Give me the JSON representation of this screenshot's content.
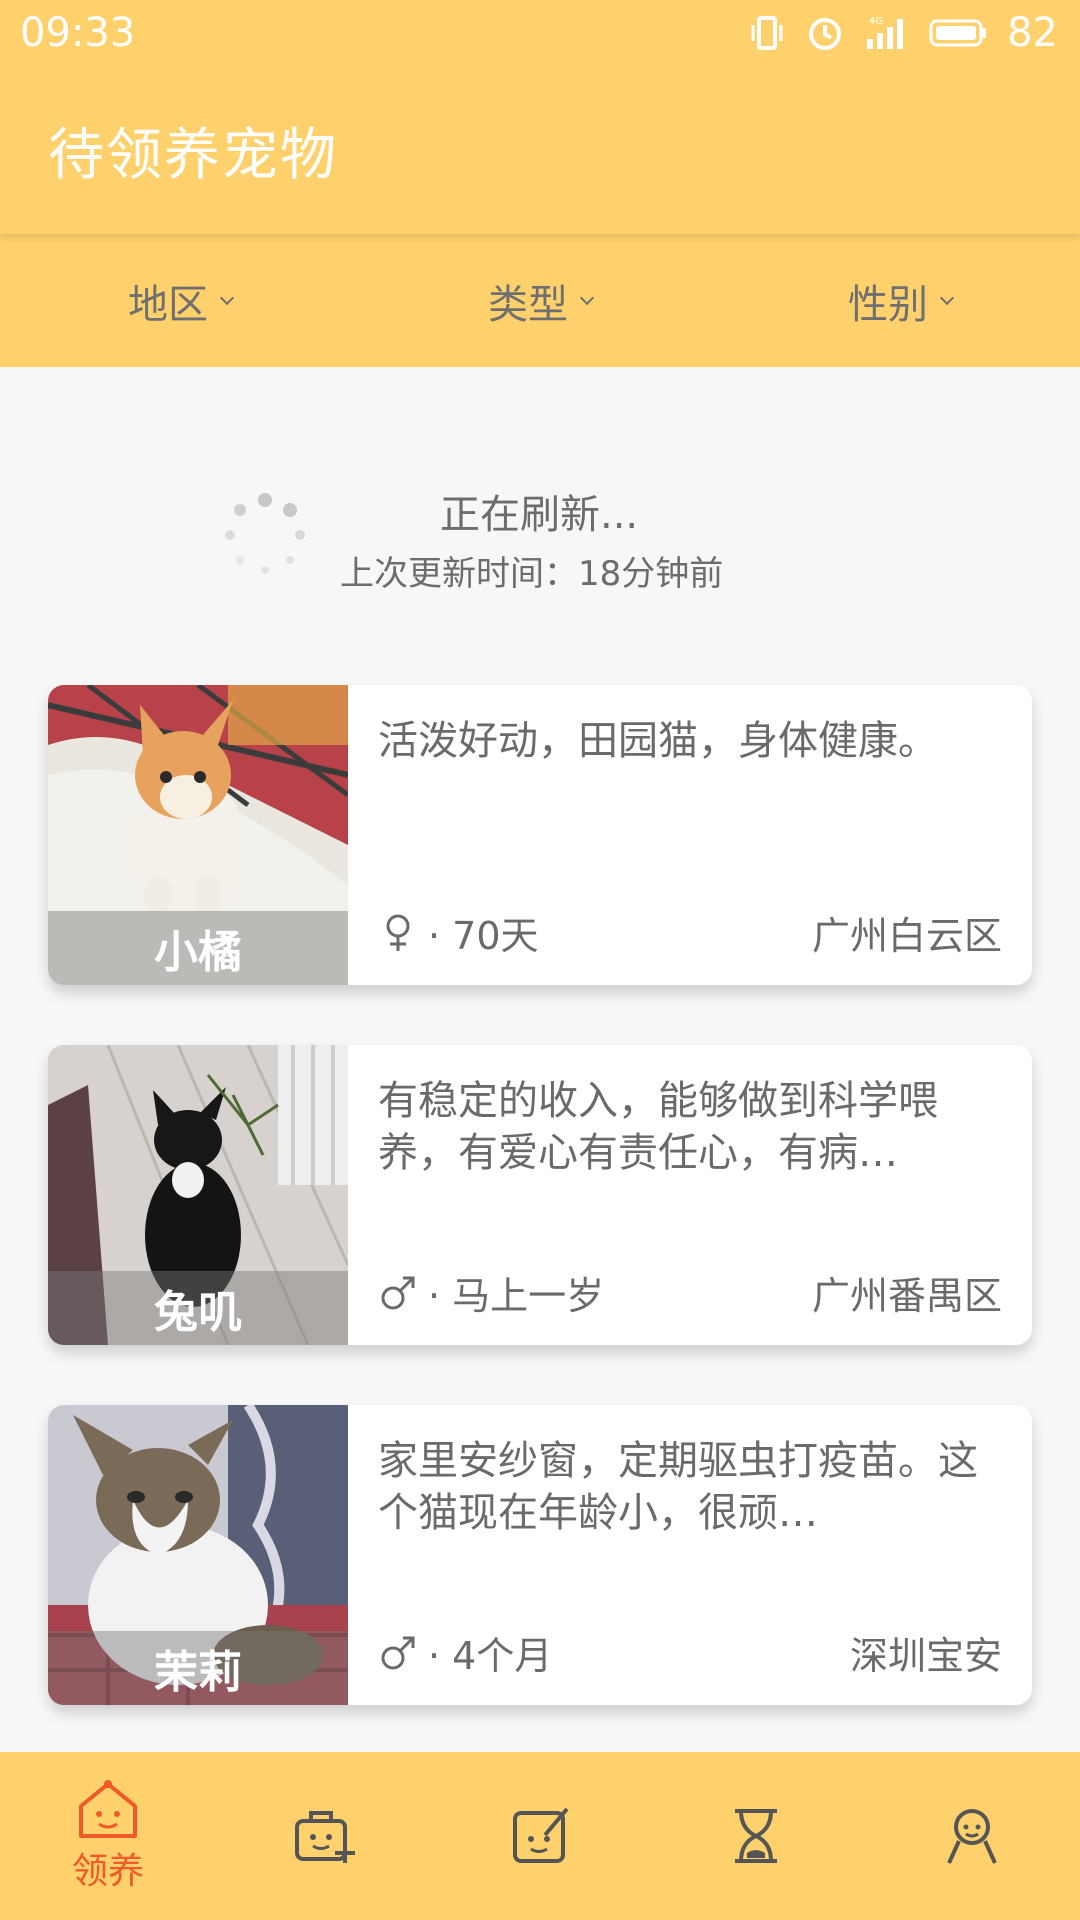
{
  "status_bar": {
    "time": "09:33",
    "network": "4G",
    "battery": "82",
    "icons": [
      "vibrate-icon",
      "alarm-icon",
      "signal-icon",
      "battery-icon"
    ]
  },
  "toolbar": {
    "title": "待领养宠物"
  },
  "filters": [
    {
      "label": "地区"
    },
    {
      "label": "类型"
    },
    {
      "label": "性别"
    }
  ],
  "refresh": {
    "title": "正在刷新...",
    "subtitle": "上次更新时间：18分钟前"
  },
  "pets": [
    {
      "name": "小橘",
      "description": "活泼好动，田园猫，身体健康。",
      "sex_icon": "female-icon",
      "age": "· 70天",
      "location": "广州白云区"
    },
    {
      "name": "兔叽",
      "description": "有稳定的收入，能够做到科学喂养，有爱心有责任心，有病…",
      "sex_icon": "male-icon",
      "age": "· 马上一岁",
      "location": "广州番禺区"
    },
    {
      "name": "茉莉",
      "description": "家里安纱窗，定期驱虫打疫苗。这个猫现在年龄小，很顽…",
      "sex_icon": "male-icon",
      "age": "· 4个月",
      "location": "深圳宝安"
    }
  ],
  "bottom_nav": [
    {
      "icon": "home-smile-icon",
      "label": "领养",
      "active": true
    },
    {
      "icon": "pet-carrier-add-icon",
      "label": "",
      "active": false
    },
    {
      "icon": "edit-note-icon",
      "label": "",
      "active": false
    },
    {
      "icon": "hourglass-icon",
      "label": "",
      "active": false
    },
    {
      "icon": "profile-icon",
      "label": "",
      "active": false
    }
  ],
  "colors": {
    "primary": "#ffd16c",
    "accent": "#f05a28",
    "text": "#6a6a6a",
    "background": "#f7f7f7"
  }
}
